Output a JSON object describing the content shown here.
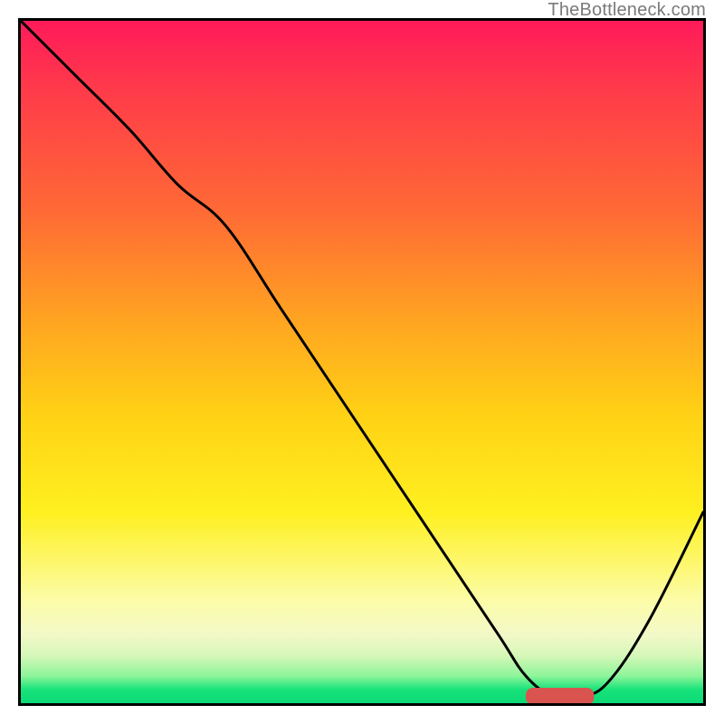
{
  "watermark": "TheBottleneck.com",
  "colors": {
    "curve": "#000000",
    "marker": "#d9534f",
    "gradient_top": "#ff1a5a",
    "gradient_mid": "#ffd215",
    "gradient_bottom": "#0cd977",
    "frame": "#000000"
  },
  "chart_data": {
    "type": "line",
    "title": "",
    "xlabel": "",
    "ylabel": "",
    "xlim": [
      0,
      100
    ],
    "ylim": [
      0,
      100
    ],
    "grid": false,
    "legend": false,
    "background_gradient": {
      "direction": "vertical",
      "stops": [
        {
          "pos": 0,
          "color": "#ff1a5a"
        },
        {
          "pos": 28,
          "color": "#ff6a35"
        },
        {
          "pos": 58,
          "color": "#ffd215"
        },
        {
          "pos": 85,
          "color": "#fcfca8"
        },
        {
          "pos": 96,
          "color": "#8df59a"
        },
        {
          "pos": 100,
          "color": "#0cd977"
        }
      ]
    },
    "series": [
      {
        "name": "curve",
        "x": [
          0,
          8,
          16,
          23,
          30,
          38,
          46,
          54,
          62,
          70,
          74,
          78,
          82,
          86,
          92,
          100
        ],
        "y": [
          100,
          92,
          84,
          76,
          70,
          58,
          46,
          34,
          22,
          10,
          4,
          1,
          1,
          3,
          12,
          28
        ]
      }
    ],
    "marker": {
      "shape": "capsule",
      "x_center": 79,
      "y": 1,
      "width": 10,
      "height": 2.5,
      "color": "#d9534f"
    },
    "note": "x,y in 0-100 of plot-area; y=0 at bottom, 100 at top; values estimated from pixels"
  }
}
